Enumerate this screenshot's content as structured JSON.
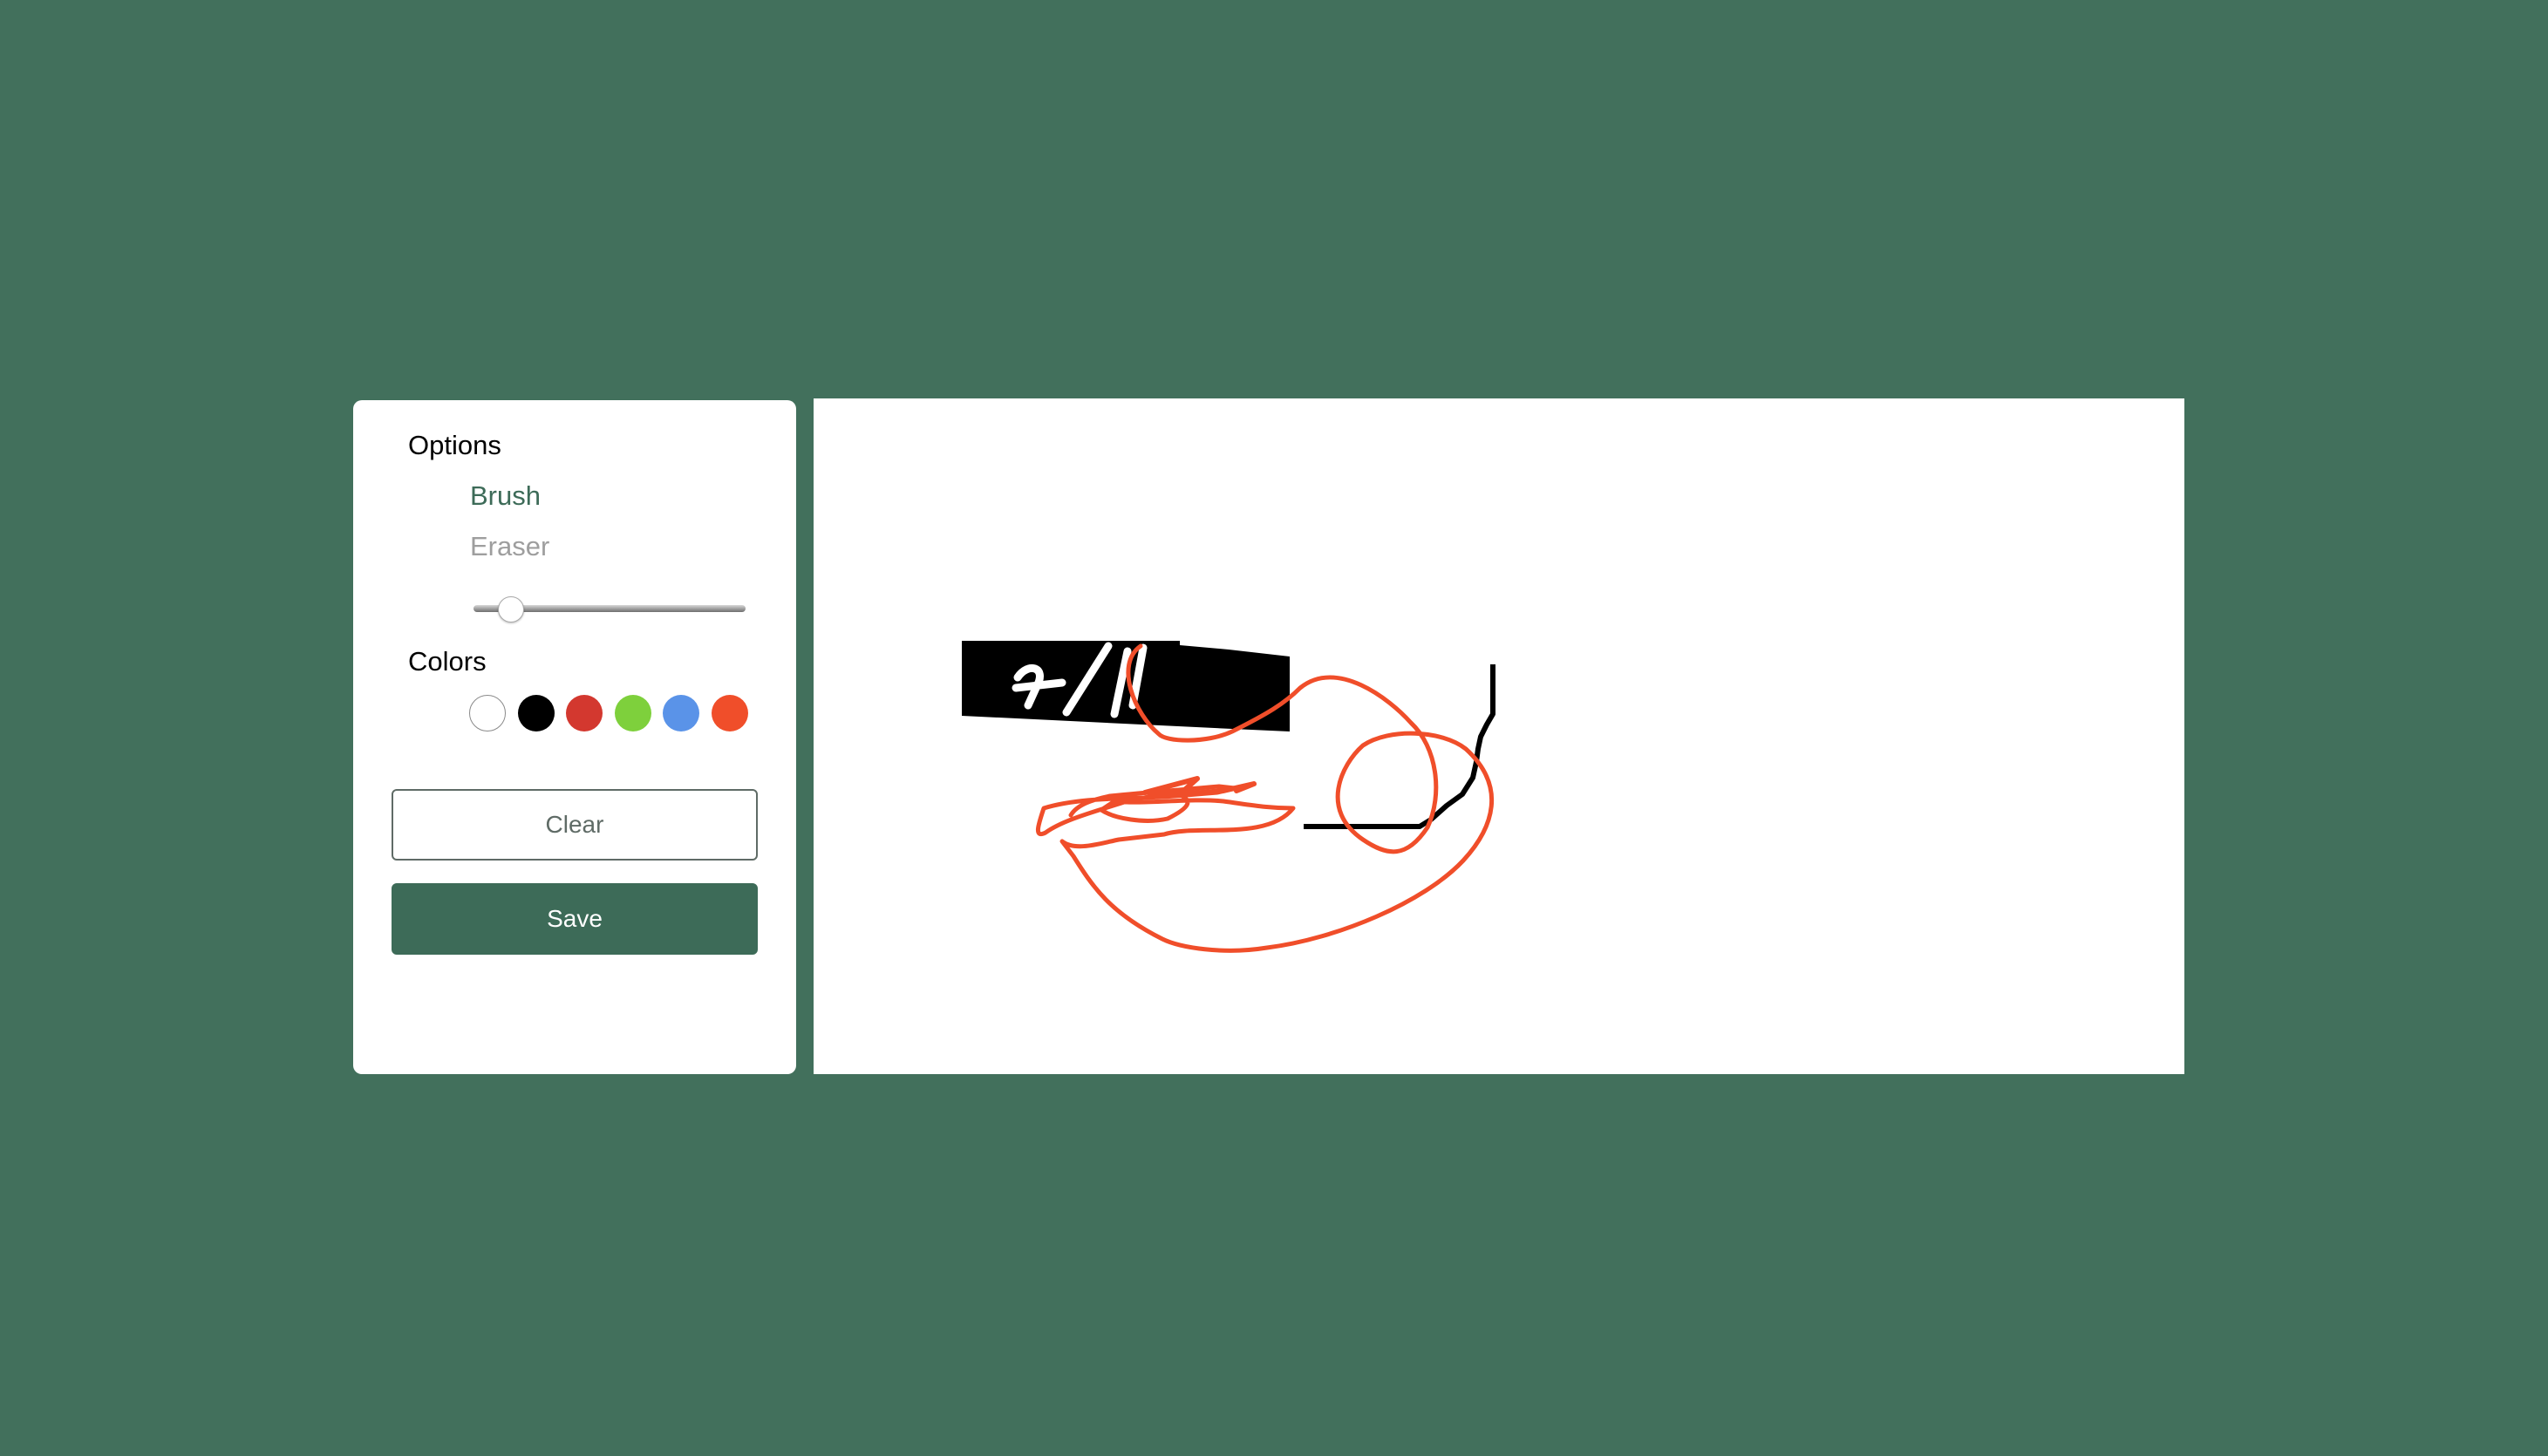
{
  "options": {
    "title": "Options",
    "tools": [
      {
        "label": "Brush",
        "state": "active"
      },
      {
        "label": "Eraser",
        "state": "inactive"
      }
    ],
    "brush_size_fraction": 0.05
  },
  "colors": {
    "title": "Colors",
    "palette": [
      "#ffffff",
      "#000000",
      "#d3382f",
      "#7ed03c",
      "#5a93e8",
      "#f04e2a"
    ],
    "selected": "#f04e2a"
  },
  "actions": {
    "clear_label": "Clear",
    "save_label": "Save"
  },
  "theme": {
    "background": "#42705c",
    "accent": "#3d6b58"
  }
}
